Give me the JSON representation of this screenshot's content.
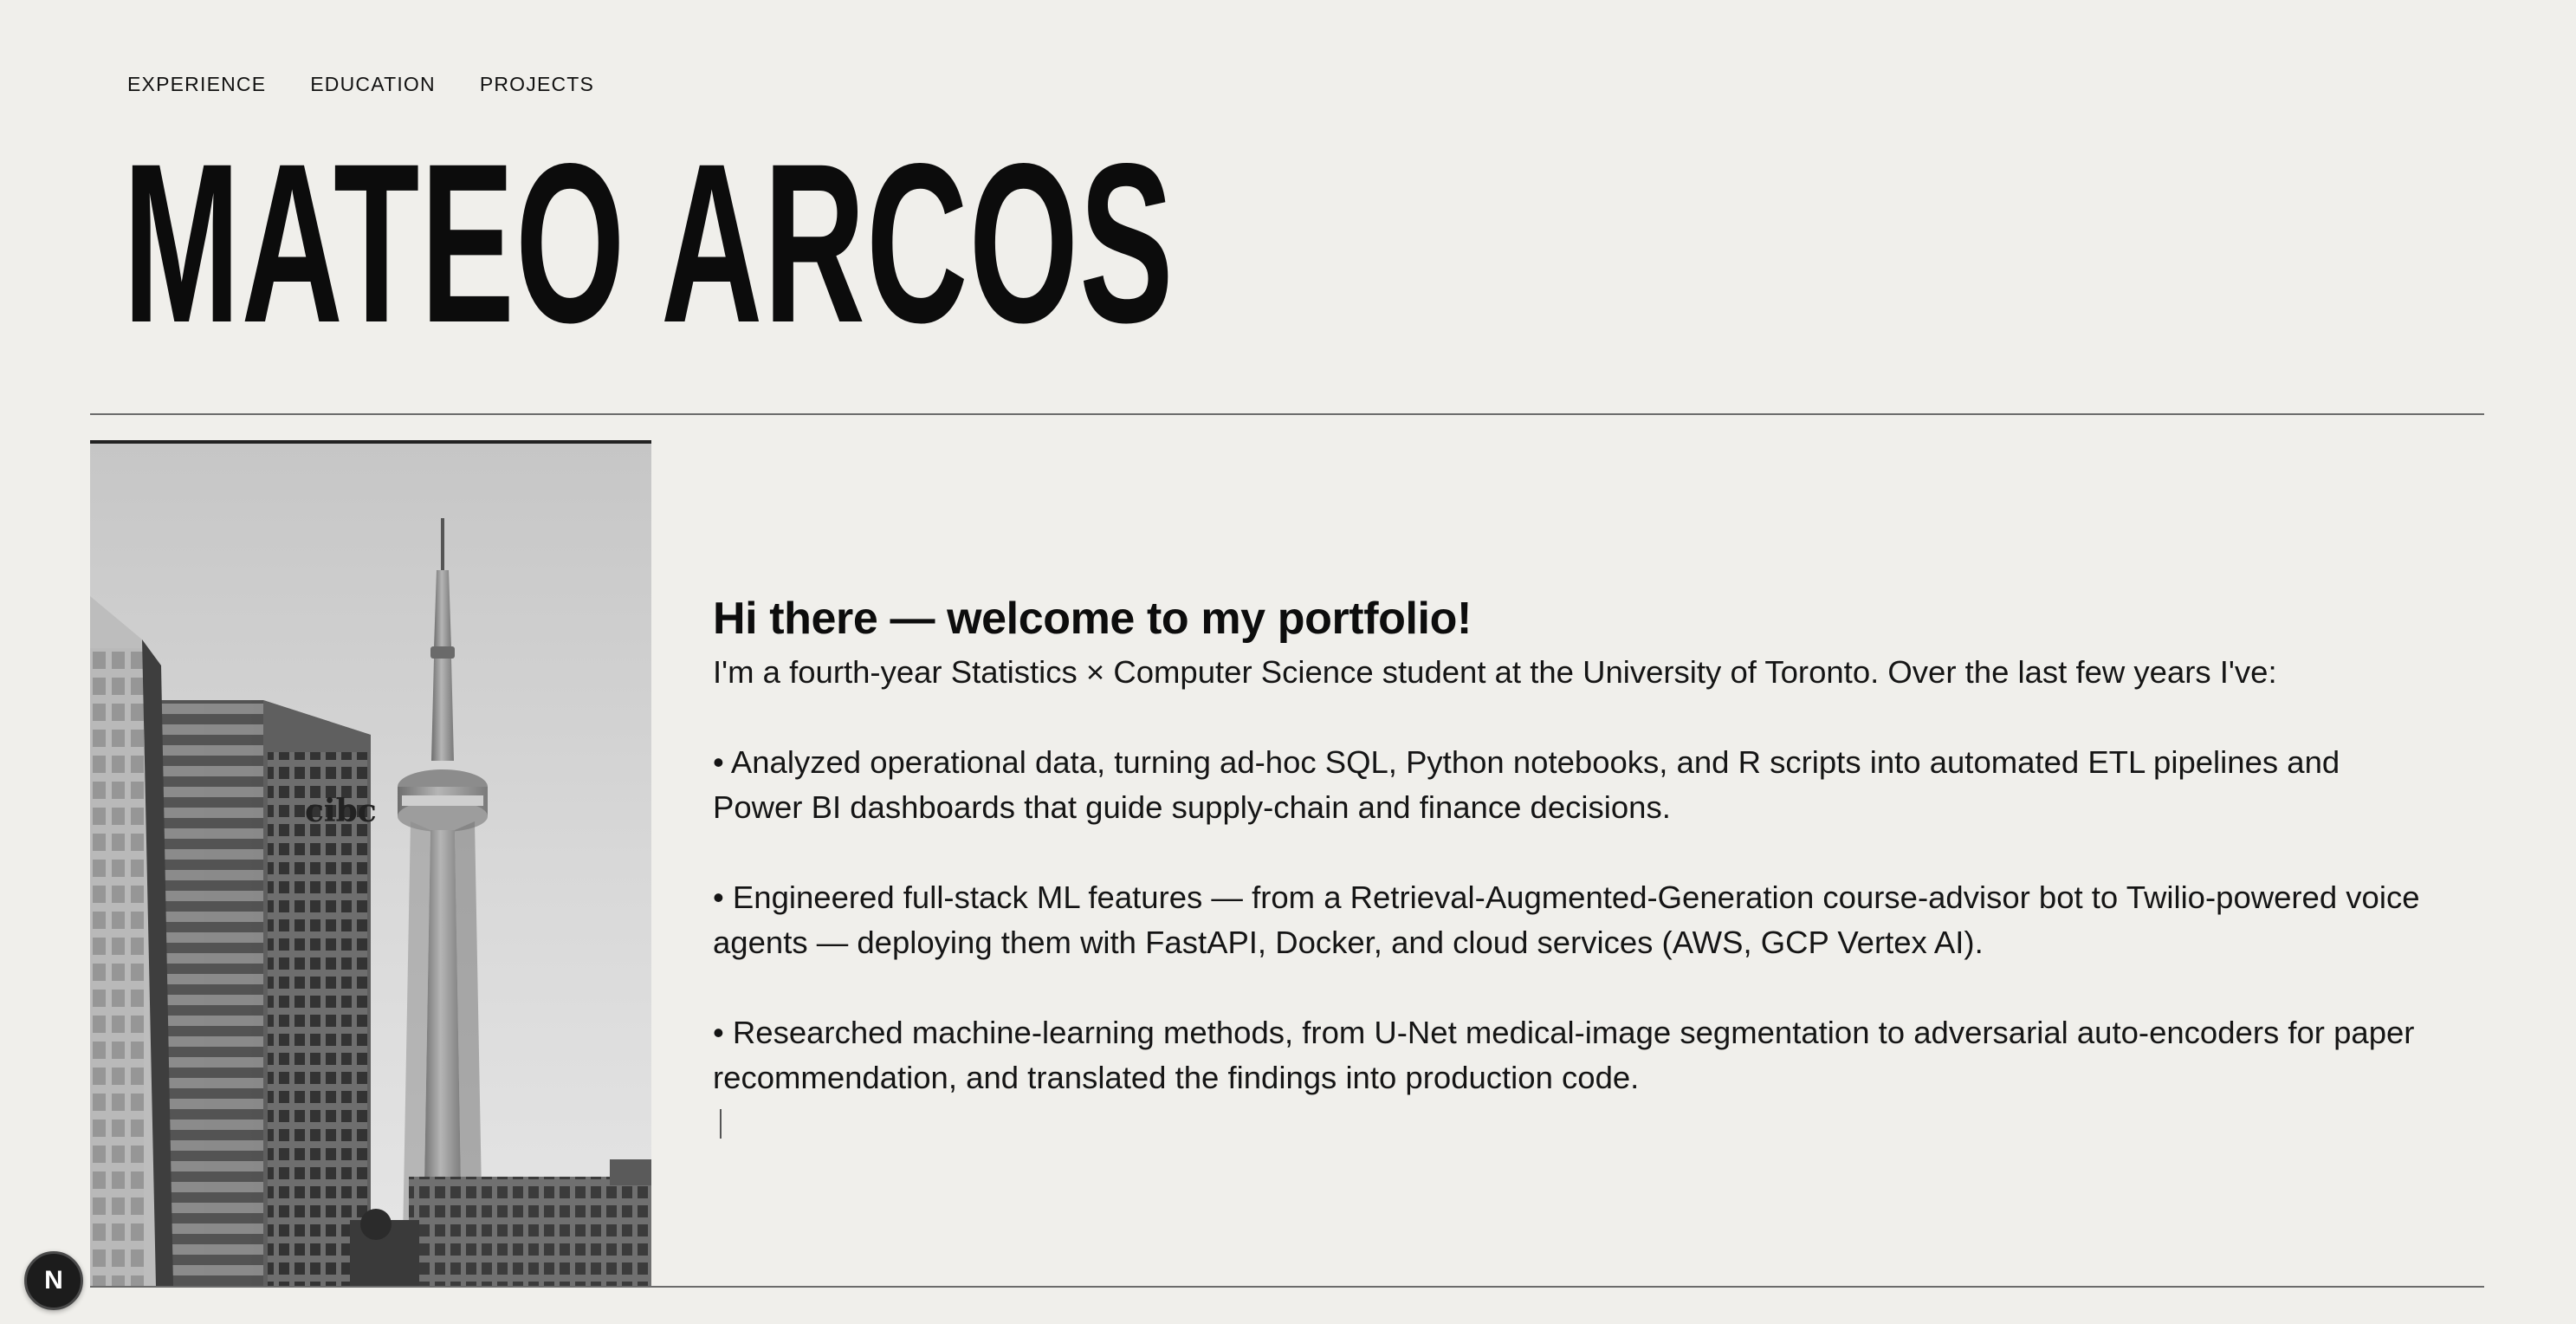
{
  "nav": {
    "items": [
      {
        "label": "EXPERIENCE"
      },
      {
        "label": "EDUCATION"
      },
      {
        "label": "PROJECTS"
      }
    ]
  },
  "hero": {
    "name": "MATEO ARCOS"
  },
  "photo": {
    "sign_text": "cibc"
  },
  "intro": {
    "heading": "Hi there — welcome to my portfolio!",
    "lead": "I'm a fourth-year Statistics × Computer Science student at the University of Toronto. Over the last few years I've:",
    "bullets": [
      "• Analyzed operational data, turning ad-hoc SQL, Python notebooks, and R scripts into automated ETL pipelines and Power BI dashboards that guide supply-chain and finance decisions.",
      "• Engineered full-stack ML features — from a Retrieval-Augmented-Generation course-advisor bot to Twilio-powered voice agents — deploying them with FastAPI, Docker, and cloud services (AWS, GCP Vertex AI).",
      "• Researched machine-learning methods, from U-Net medical-image segmentation to adversarial auto-encoders for paper recommendation, and translated the findings into production code."
    ]
  },
  "dev_badge": {
    "label": "N"
  },
  "colors": {
    "background": "#f0efeb",
    "text": "#111111",
    "rule": "#6b6b6b",
    "badge": "#1c1c1c"
  },
  "icons": {
    "dev_badge": "nextjs-logo-icon"
  }
}
